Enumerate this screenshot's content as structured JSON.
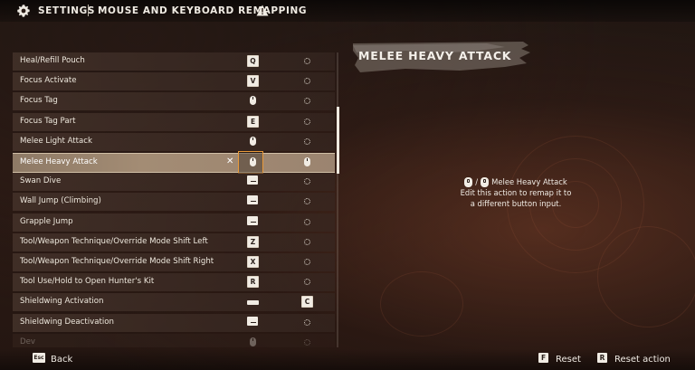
{
  "header": {
    "title": "SETTINGS",
    "subtitle": "MOUSE AND KEYBOARD REMAPPING",
    "gear_icon": "gear-icon",
    "warning_icon": "warning-icon"
  },
  "bindings": [
    {
      "label": "Heal/Refill Pouch",
      "primary": "Q",
      "primary_type": "key",
      "secondary_type": "empty"
    },
    {
      "label": "Focus Activate",
      "primary": "V",
      "primary_type": "key",
      "secondary_type": "empty"
    },
    {
      "label": "Focus Tag",
      "primary": "",
      "primary_type": "mouse",
      "secondary_type": "empty"
    },
    {
      "label": "Focus Tag Part",
      "primary": "E",
      "primary_type": "key",
      "secondary_type": "empty"
    },
    {
      "label": "Melee Light Attack",
      "primary": "",
      "primary_type": "mouse",
      "secondary_type": "empty"
    },
    {
      "label": "Melee Heavy Attack",
      "primary": "",
      "primary_type": "mouse",
      "secondary_type": "mouse",
      "selected": true
    },
    {
      "label": "Swan Dive",
      "primary": "",
      "primary_type": "wide",
      "secondary_type": "empty"
    },
    {
      "label": "Wall Jump (Climbing)",
      "primary": "",
      "primary_type": "wide",
      "secondary_type": "empty"
    },
    {
      "label": "Grapple Jump",
      "primary": "",
      "primary_type": "wide",
      "secondary_type": "empty"
    },
    {
      "label": "Tool/Weapon Technique/Override Mode Shift Left",
      "primary": "Z",
      "primary_type": "key",
      "secondary_type": "empty"
    },
    {
      "label": "Tool/Weapon Technique/Override Mode Shift Right",
      "primary": "X",
      "primary_type": "key",
      "secondary_type": "empty"
    },
    {
      "label": "Tool Use/Hold to Open Hunter's Kit",
      "primary": "R",
      "primary_type": "key",
      "secondary_type": "empty"
    },
    {
      "label": "Shieldwing Activation",
      "primary": "",
      "primary_type": "space",
      "secondary": "C",
      "secondary_type": "key"
    },
    {
      "label": "Shieldwing Deactivation",
      "primary": "",
      "primary_type": "wide",
      "secondary_type": "empty"
    },
    {
      "label": "Dev",
      "primary": "",
      "primary_type": "mouse",
      "secondary_type": "empty",
      "dim": true
    }
  ],
  "selected_row": {
    "clear_glyph": "✕"
  },
  "detail": {
    "title": "MELEE HEAVY ATTACK",
    "separator": "/",
    "action_name": "Melee Heavy Attack",
    "line2": "Edit this action to remap it to",
    "line3": "a different button input."
  },
  "footer": {
    "back_key": "Esc",
    "back_label": "Back",
    "reset_key": "F",
    "reset_label": "Reset",
    "reset_action_key": "R",
    "reset_action_label": "Reset action"
  }
}
